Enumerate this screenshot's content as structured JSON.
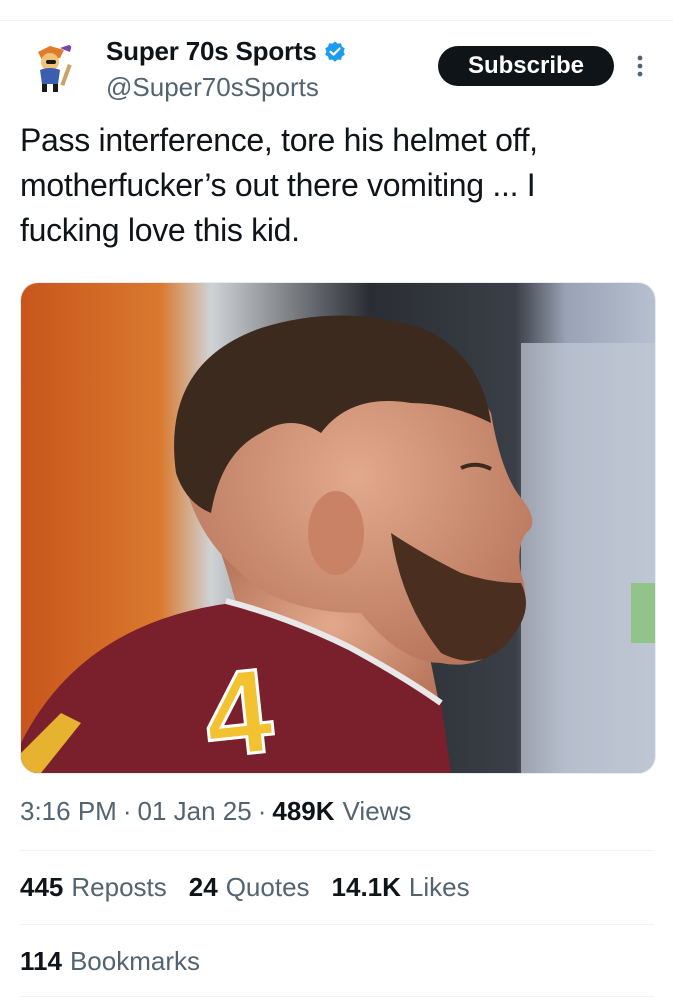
{
  "author": {
    "display_name": "Super 70s Sports",
    "handle": "@Super70sSports",
    "verified": true,
    "avatar_icon": "retro-mascot-avatar"
  },
  "header": {
    "subscribe_label": "Subscribe",
    "more_icon": "vertical-ellipsis-icon"
  },
  "tweet": {
    "text_lines": [
      "Pass interference, tore his helmet off,",
      "motherfucker’s out there vomiting ... I",
      "fucking love this kid."
    ]
  },
  "media": {
    "jersey_number": "4",
    "colors": {
      "jersey": "#7a1f2c",
      "number": "#f2c230"
    }
  },
  "meta": {
    "time": "3:16 PM",
    "date": "01 Jan 25",
    "views_count": "489K",
    "views_label": "Views"
  },
  "stats": {
    "reposts_count": "445",
    "reposts_label": "Reposts",
    "quotes_count": "24",
    "quotes_label": "Quotes",
    "likes_count": "14.1K",
    "likes_label": "Likes",
    "bookmarks_count": "114",
    "bookmarks_label": "Bookmarks"
  },
  "colors": {
    "text": "#0f1419",
    "secondary": "#536471",
    "verified": "#1d9bf0",
    "divider": "#eff3f4"
  }
}
